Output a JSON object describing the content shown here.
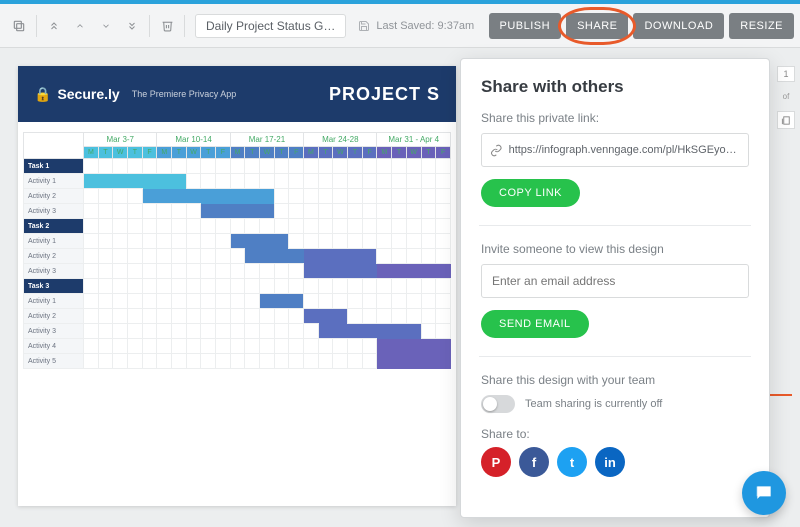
{
  "toolbar": {
    "doc_title": "Daily Project Status G…",
    "last_saved_label": "Last Saved: 9:37am",
    "buttons": {
      "publish": "PUBLISH",
      "share": "SHARE",
      "download": "DOWNLOAD",
      "resize": "RESIZE"
    }
  },
  "rail": {
    "page": "1",
    "of": "of"
  },
  "canvas": {
    "brand_name": "Secure.ly",
    "brand_tag": "The Premiere Privacy App",
    "title": "PROJECT S"
  },
  "chart_data": {
    "type": "gantt",
    "months": [
      "Mar 3-7",
      "Mar 10-14",
      "Mar 17-21",
      "Mar 24-28",
      "Mar 31 - Apr 4"
    ],
    "dow": [
      "M",
      "T",
      "W",
      "T",
      "F"
    ],
    "dow_bg": [
      "#4cc0de",
      "#4a9fd8",
      "#4f7fc4",
      "#5b6fbf",
      "#6a62b9"
    ],
    "bar_palette": [
      "#4cc0de",
      "#4a9fd8",
      "#4f7fc4",
      "#5b6fbf",
      "#6a62b9",
      "#7a5cb4"
    ],
    "rows": [
      {
        "label": "Task 1",
        "task": true
      },
      {
        "label": "Activity 1",
        "bars": [
          {
            "start": 0,
            "span": 7,
            "c": 0
          }
        ]
      },
      {
        "label": "Activity 2",
        "bars": [
          {
            "start": 4,
            "span": 9,
            "c": 1
          }
        ]
      },
      {
        "label": "Activity 3",
        "bars": [
          {
            "start": 8,
            "span": 5,
            "c": 2
          }
        ]
      },
      {
        "label": "Task 2",
        "task": true
      },
      {
        "label": "Activity 1",
        "bars": [
          {
            "start": 10,
            "span": 4,
            "c": 2
          }
        ]
      },
      {
        "label": "Activity 2",
        "bars": [
          {
            "start": 11,
            "span": 4,
            "c": 2
          },
          {
            "start": 15,
            "span": 5,
            "c": 3
          }
        ]
      },
      {
        "label": "Activity 3",
        "bars": [
          {
            "start": 15,
            "span": 5,
            "c": 3
          },
          {
            "start": 20,
            "span": 5,
            "c": 4
          }
        ]
      },
      {
        "label": "Task 3",
        "task": true
      },
      {
        "label": "Activity 1",
        "bars": [
          {
            "start": 12,
            "span": 3,
            "c": 2
          }
        ]
      },
      {
        "label": "Activity 2",
        "bars": [
          {
            "start": 15,
            "span": 3,
            "c": 3
          }
        ]
      },
      {
        "label": "Activity 3",
        "bars": [
          {
            "start": 16,
            "span": 7,
            "c": 3
          }
        ]
      },
      {
        "label": "Activity 4",
        "bars": [
          {
            "start": 20,
            "span": 5,
            "c": 4
          }
        ]
      },
      {
        "label": "Activity 5",
        "bars": [
          {
            "start": 20,
            "span": 5,
            "c": 4
          }
        ]
      }
    ]
  },
  "share_panel": {
    "heading": "Share with others",
    "link_label": "Share this private link:",
    "link_url": "https://infograph.venngage.com/pl/HkSGEyoQsU",
    "copy_btn": "COPY LINK",
    "invite_label": "Invite someone to view this design",
    "email_placeholder": "Enter an email address",
    "send_btn": "SEND EMAIL",
    "team_label": "Share this design with your team",
    "team_status": "Team sharing is currently off",
    "share_to": "Share to:",
    "social": [
      {
        "name": "pinterest",
        "bg": "#d52129",
        "glyph": "P"
      },
      {
        "name": "facebook",
        "bg": "#3b5998",
        "glyph": "f"
      },
      {
        "name": "twitter",
        "bg": "#1da1f2",
        "glyph": "t"
      },
      {
        "name": "linkedin",
        "bg": "#0a66c2",
        "glyph": "in"
      }
    ]
  }
}
